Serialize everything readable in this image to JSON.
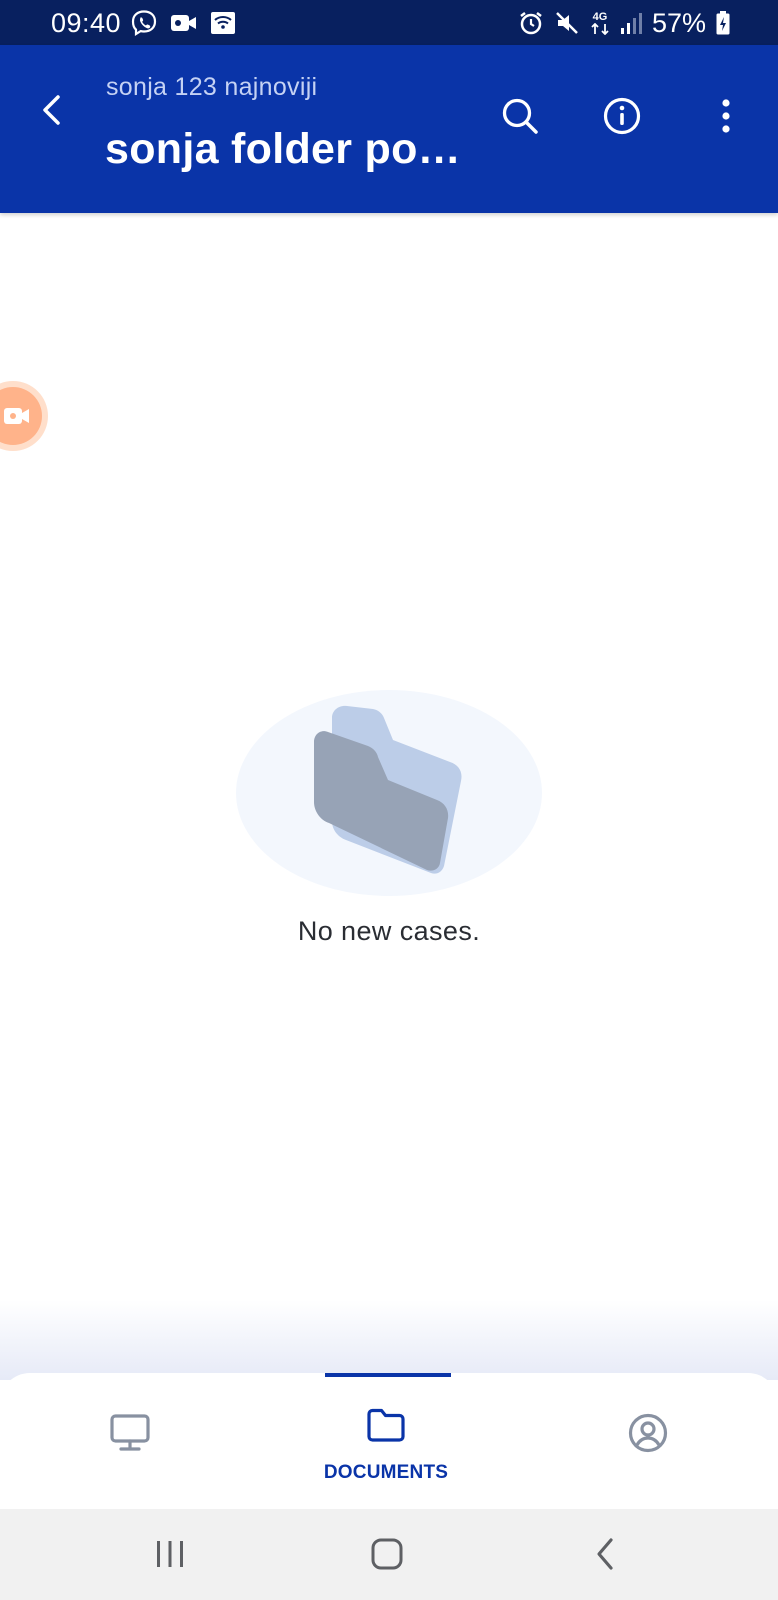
{
  "status_bar": {
    "time": "09:40",
    "left_icons": [
      "viber-icon",
      "video-camera-icon",
      "wifi-calling-icon"
    ],
    "right_icons": [
      "alarm-icon",
      "mute-icon",
      "network-4g-icon",
      "signal-icon",
      "battery-charging-icon"
    ],
    "network_label": "4G",
    "battery": "57%"
  },
  "app_bar": {
    "subtitle": "sonja 123 najnoviji",
    "title": "sonja folder po…",
    "background_color": "#0a34a8",
    "actions": [
      "back-icon",
      "search-icon",
      "info-icon",
      "more-vertical-icon"
    ]
  },
  "empty_state": {
    "message": "No new cases."
  },
  "bottom_nav": {
    "items": [
      {
        "id": "dashboard",
        "icon": "monitor-icon",
        "label": "",
        "active": false
      },
      {
        "id": "documents",
        "icon": "folder-icon",
        "label": "DOCUMENTS",
        "active": true
      },
      {
        "id": "profile",
        "icon": "account-circle-icon",
        "label": "",
        "active": false
      }
    ],
    "accent_color": "#0a34a8"
  },
  "system_nav": {
    "buttons": [
      "recents-icon",
      "home-icon",
      "system-back-icon"
    ]
  },
  "floating_button": {
    "icon": "video-record-icon",
    "color": "#ffb38a"
  }
}
